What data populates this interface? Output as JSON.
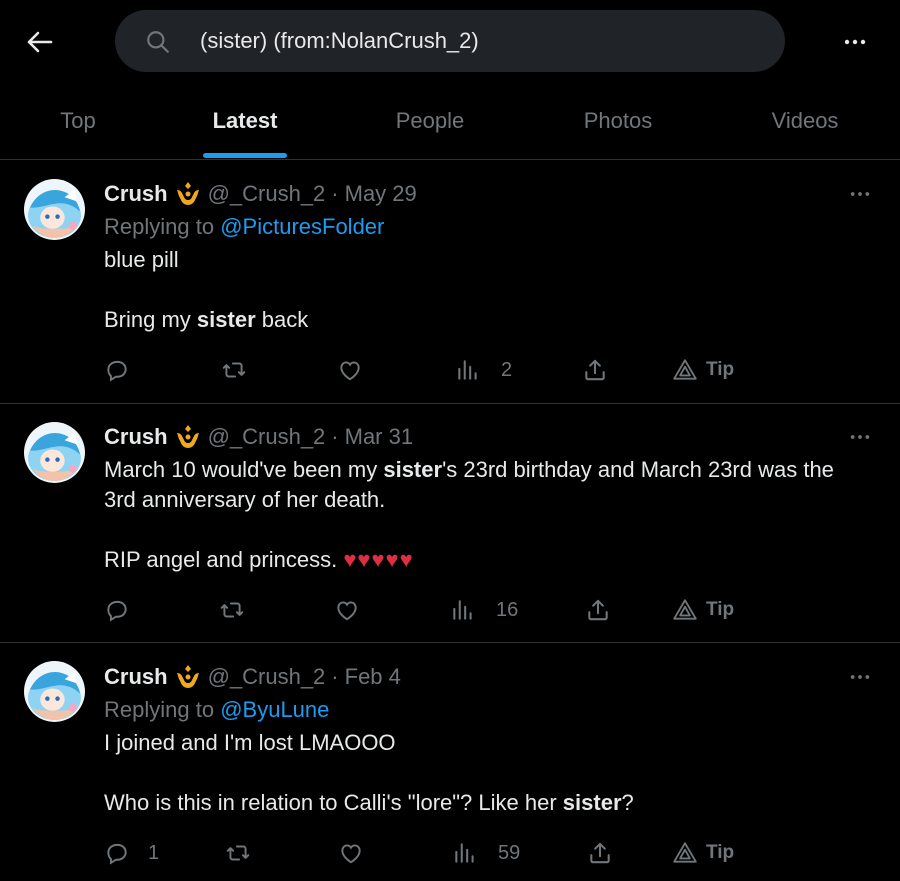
{
  "search": {
    "query": "(sister) (from:NolanCrush_2)"
  },
  "tabs": [
    {
      "label": "Top"
    },
    {
      "label": "Latest"
    },
    {
      "label": "People"
    },
    {
      "label": "Photos"
    },
    {
      "label": "Videos"
    }
  ],
  "active_tab": "Latest",
  "colors": {
    "accent": "#1d9bf0",
    "muted": "#71767b",
    "heart": "#dd2e44",
    "badge": "#f0a81c"
  },
  "tweets": [
    {
      "name": "Crush",
      "handle": "@_Crush_2",
      "date": "May 29",
      "replying_prefix": "Replying to",
      "replying_to": "@PicturesFolder",
      "line1": "blue pill",
      "line2_pre": "Bring my ",
      "line2_hl": "sister",
      "line2_post": " back",
      "reply_count": "",
      "retweet_count": "",
      "like_count": "",
      "view_count": "2",
      "tip_label": "Tip"
    },
    {
      "name": "Crush",
      "handle": "@_Crush_2",
      "date": "Mar 31",
      "line1_pre": "March 10 would've been my ",
      "line1_hl": "sister",
      "line1_post": "'s 23rd birthday and March 23rd was the",
      "line2": "3rd anniversary of her death.",
      "line3": "RIP angel and princess.",
      "hearts": "♥♥♥♥♥",
      "reply_count": "",
      "retweet_count": "",
      "like_count": "",
      "view_count": "16",
      "tip_label": "Tip"
    },
    {
      "name": "Crush",
      "handle": "@_Crush_2",
      "date": "Feb 4",
      "replying_prefix": "Replying to",
      "replying_to": "@ByuLune",
      "line1": "I joined and I'm lost LMAOOO",
      "line2_pre": "Who is this in relation to Calli's \"lore\"? Like her ",
      "line2_hl": "sister",
      "line2_post": "?",
      "reply_count": "1",
      "retweet_count": "",
      "like_count": "",
      "view_count": "59",
      "tip_label": "Tip"
    }
  ]
}
